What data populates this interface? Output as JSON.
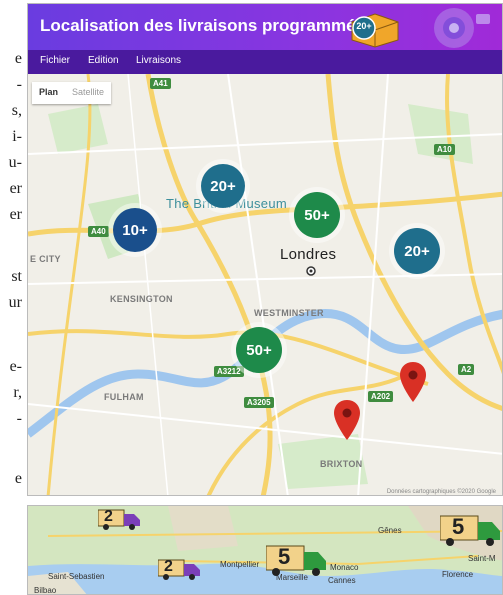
{
  "side_text": [
    "e",
    "-",
    "s,",
    "i-",
    "u-",
    "er",
    "er",
    "st",
    "ur",
    "e-",
    "r,",
    "-",
    "e"
  ],
  "window": {
    "title": "Localisation des livraisons programmées"
  },
  "header_badge": "20+",
  "menu": [
    "Fichier",
    "Edition",
    "Livraisons"
  ],
  "map_type": {
    "plan": "Plan",
    "satellite": "Satellite"
  },
  "clusters": [
    {
      "label": "20+",
      "color": "#1f6e8c"
    },
    {
      "label": "10+",
      "color": "#1a4f8c"
    },
    {
      "label": "50+",
      "color": "#1e8a4a"
    },
    {
      "label": "20+",
      "color": "#1f6e8c"
    },
    {
      "label": "50+",
      "color": "#1e8a4a"
    }
  ],
  "places": {
    "museum": "The British Museum",
    "city": "Londres",
    "kensington": "KENSINGTON",
    "westminster": "WESTMINSTER",
    "fulham": "FULHAM",
    "brixton": "BRIXTON",
    "ecity": "E CITY"
  },
  "roads": [
    "A41",
    "A40",
    "A10",
    "A3212",
    "A3205",
    "A202",
    "A2"
  ],
  "pins_color": "#d93025",
  "footer_credit": "Données cartographiques ©2020 Google",
  "strip": {
    "trucks": [
      {
        "number": "2",
        "color": "#7b3fb8"
      },
      {
        "number": "2",
        "color": "#7b3fb8"
      },
      {
        "number": "5",
        "color": "#2e9a3e"
      },
      {
        "number": "5",
        "color": "#2e9a3e"
      }
    ],
    "cities": [
      "Gênes",
      "Montpellier",
      "Monaco",
      "Marseille",
      "Cannes",
      "Florence",
      "Saint-M",
      "Saint-Sebastien",
      "Bilbao"
    ]
  }
}
